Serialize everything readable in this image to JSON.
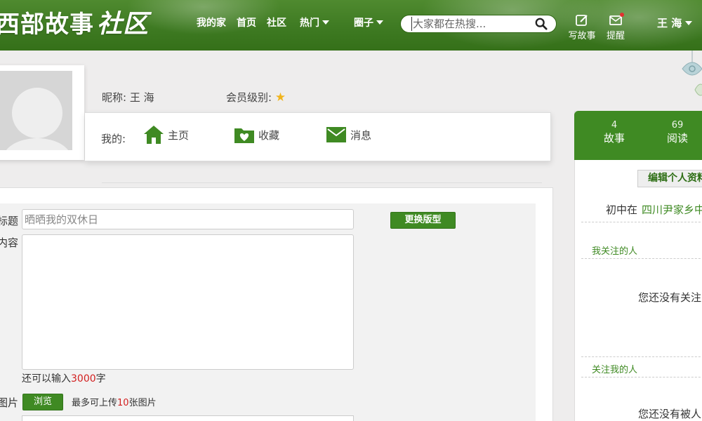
{
  "header": {
    "logo_main": "西部故事",
    "logo_script": "社区",
    "nav": [
      "我的家",
      "首页",
      "社区"
    ],
    "nav_dropdowns": [
      "热门",
      "圈子"
    ],
    "search_placeholder": "大家都在热搜...",
    "write_label": "写故事",
    "remind_label": "提醒",
    "user_name": "王 海"
  },
  "profile": {
    "nickname_label": "昵称:",
    "nickname": "王 海",
    "level_label": "会员级别:",
    "level_stars": 1,
    "mine_label": "我的:",
    "links": [
      "主页",
      "收藏",
      "消息"
    ]
  },
  "form": {
    "title_label": "标题",
    "title_placeholder": "晒晒我的双休日",
    "content_label": "内容",
    "change_layout_btn": "更换版型",
    "remaining_prefix": "还可以输入",
    "remaining_count": "3000",
    "remaining_suffix": "字",
    "image_label": "图片",
    "browse_btn": "浏览",
    "upload_prefix": "最多可上传",
    "upload_count": "10",
    "upload_suffix": "张图片"
  },
  "sidebar": {
    "stats": [
      {
        "value": "4",
        "label": "故事"
      },
      {
        "value": "69",
        "label": "阅读"
      }
    ],
    "edit_profile_btn": "编辑个人资料",
    "school_label": "初中在",
    "school_value": "四川尹家乡中",
    "following_title": "我关注的人",
    "following_empty": "您还没有关注",
    "followers_title": "关注我的人",
    "followers_empty": "您还没有被人"
  },
  "colors": {
    "brand_green": "#3f8a23",
    "header_green": "#3e7a22",
    "accent_red": "#d21e1e",
    "star_gold": "#f0b41c"
  }
}
